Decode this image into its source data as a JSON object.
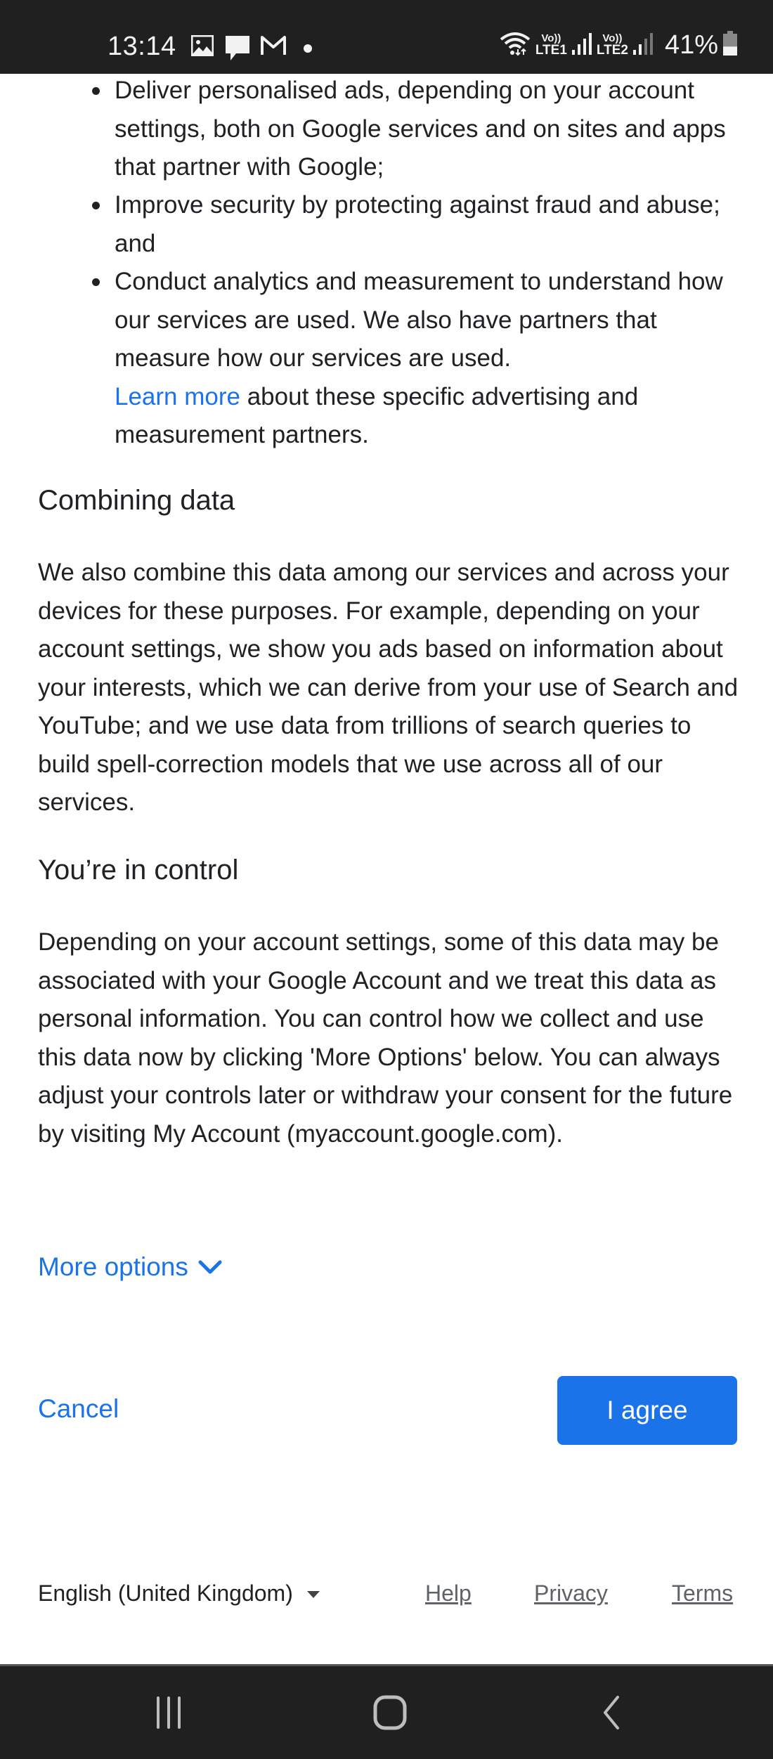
{
  "status_bar": {
    "time": "13:14",
    "notification_icons": [
      "gallery-icon",
      "message-icon",
      "gmail-icon",
      "dot-icon"
    ],
    "sim1_label_top": "Vo))",
    "sim1_label_bottom": "LTE1",
    "sim2_label_top": "Vo))",
    "sim2_label_bottom": "LTE2",
    "battery_percent": "41%",
    "battery_level": 0.41
  },
  "bullets": [
    {
      "text": "Deliver personalised ads, depending on your account settings, both on Google services and on sites and apps that partner with Google;"
    },
    {
      "text": "Improve security by protecting against fraud and abuse; and"
    },
    {
      "text": "Conduct analytics and measurement to understand how our services are used. We also have partners that measure how our services are used.",
      "link_text": "Learn more",
      "after_link": " about these specific advertising and measurement partners."
    }
  ],
  "sections": [
    {
      "heading": "Combining data",
      "body": "We also combine this data among our services and across your devices for these purposes. For example, depending on your account settings, we show you ads based on information about your interests, which we can derive from your use of Search and YouTube; and we use data from trillions of search queries to build spell-correction models that we use across all of our services."
    },
    {
      "heading": "You’re in control",
      "body": "Depending on your account settings, some of this data may be associated with your Google Account and we treat this data as personal information. You can control how we collect and use this data now by clicking 'More Options' below. You can always adjust your controls later or withdraw your consent for the future by visiting My Account (myaccount.google.com)."
    }
  ],
  "actions": {
    "more_options": "More options",
    "cancel": "Cancel",
    "agree": "I agree"
  },
  "footer": {
    "language": "English (United Kingdom)",
    "help": "Help",
    "privacy": "Privacy",
    "terms": "Terms"
  },
  "colors": {
    "accent": "#1a73e8",
    "text": "#202124",
    "muted": "#5f6368",
    "system_bar": "#202020"
  }
}
